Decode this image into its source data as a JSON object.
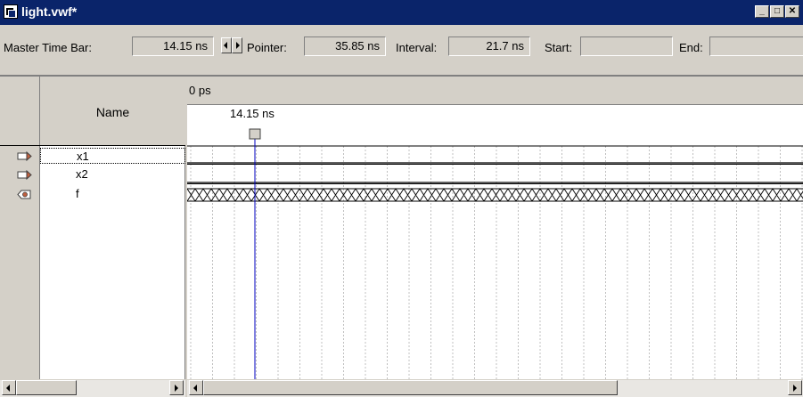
{
  "window": {
    "title": "light.vwf*"
  },
  "toolbar": {
    "master_time_bar_label": "Master Time Bar:",
    "master_time_bar_value": "14.15 ns",
    "pointer_label": "Pointer:",
    "pointer_value": "35.85 ns",
    "interval_label": "Interval:",
    "interval_value": "21.7 ns",
    "start_label": "Start:",
    "start_value": "",
    "end_label": "End:",
    "end_value": ""
  },
  "grid": {
    "name_header": "Name",
    "time_origin": "0 ps",
    "marker_label": "14.15 ns"
  },
  "signals": [
    {
      "name": "x1",
      "type": "input",
      "waveform": "low"
    },
    {
      "name": "x2",
      "type": "input",
      "waveform": "low"
    },
    {
      "name": "f",
      "type": "output",
      "waveform": "undefined"
    }
  ],
  "colors": {
    "title_bar": "#0a246a",
    "marker_line": "#0000c0",
    "grid_line": "#c0c0c0"
  }
}
